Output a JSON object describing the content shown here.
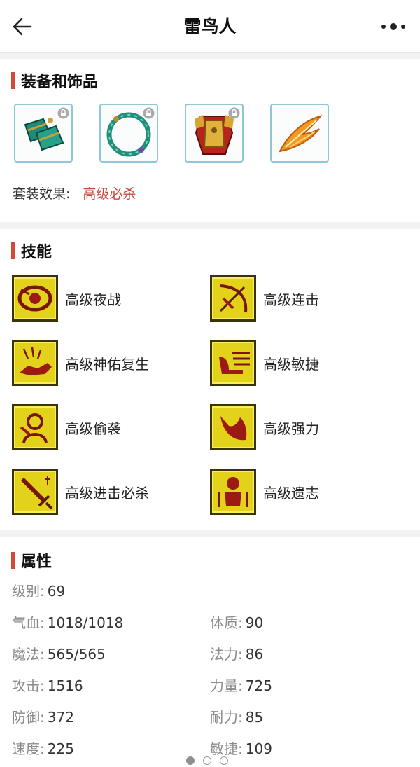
{
  "header": {
    "title": "雷鸟人"
  },
  "equipment": {
    "section_title": "装备和饰品",
    "items": [
      {
        "icon": "bracer-icon",
        "locked": true
      },
      {
        "icon": "necklace-icon",
        "locked": true
      },
      {
        "icon": "armor-icon",
        "locked": true
      },
      {
        "icon": "wing-icon",
        "locked": false
      }
    ],
    "set_label": "套装效果:",
    "set_value": "高级必杀"
  },
  "skills": {
    "section_title": "技能",
    "items": [
      {
        "name": "高级夜战",
        "icon": "eye-skill-icon"
      },
      {
        "name": "高级连击",
        "icon": "bow-skill-icon"
      },
      {
        "name": "高级神佑复生",
        "icon": "wolf-skill-icon"
      },
      {
        "name": "高级敏捷",
        "icon": "speed-skill-icon"
      },
      {
        "name": "高级偷袭",
        "icon": "sneak-skill-icon"
      },
      {
        "name": "高级强力",
        "icon": "arm-skill-icon"
      },
      {
        "name": "高级进击必杀",
        "icon": "sword-skill-icon"
      },
      {
        "name": "高级遗志",
        "icon": "figure-skill-icon"
      }
    ]
  },
  "attributes": {
    "section_title": "属性",
    "level_label": "级别:",
    "level_value": "69",
    "hp_label": "气血:",
    "hp_value": "1018/1018",
    "mp_label": "魔法:",
    "mp_value": "565/565",
    "atk_label": "攻击:",
    "atk_value": "1516",
    "def_label": "防御:",
    "def_value": "372",
    "spd_label": "速度:",
    "spd_value": "225",
    "con_label": "体质:",
    "con_value": "90",
    "mag_label": "法力:",
    "mag_value": "86",
    "str_label": "力量:",
    "str_value": "725",
    "end_label": "耐力:",
    "end_value": "85",
    "agi_label": "敏捷:",
    "agi_value": "109"
  },
  "pager": {
    "current": 1,
    "total": 3
  },
  "colors": {
    "accent": "#d44a3a",
    "set_value": "#c7473b",
    "item_border": "#8fc7d4",
    "skill_bg": "#e2d21a"
  }
}
